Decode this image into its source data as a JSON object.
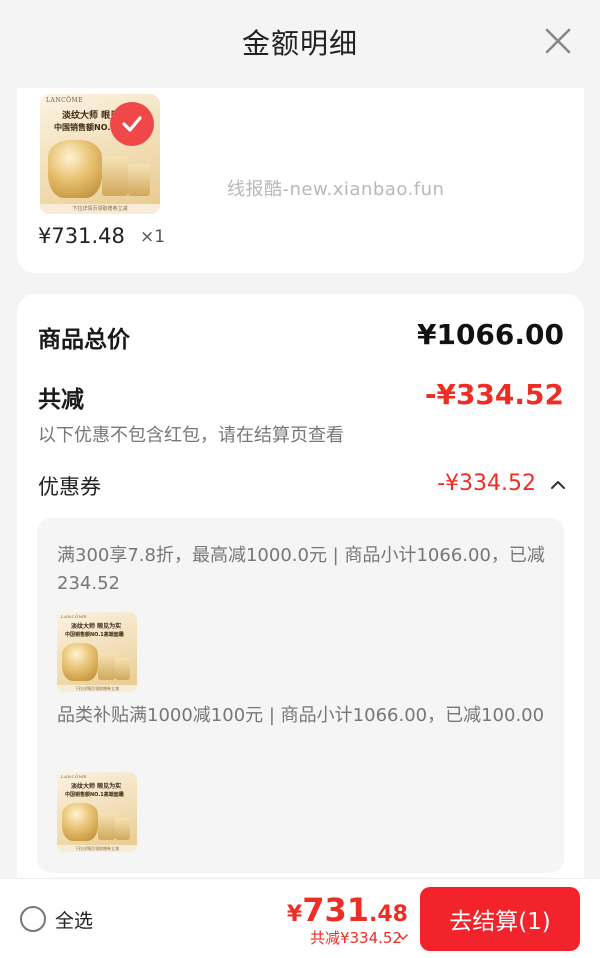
{
  "header": {
    "title": "金额明细"
  },
  "product": {
    "brand": "LANCÔME",
    "image_line1": "淡纹大师 眼见为实",
    "image_line2": "中国销售额NO.1高端面霜",
    "image_strip": "下拉详情页领取赠券立减",
    "price": "¥731.48",
    "quantity": "×1"
  },
  "watermark": "线报酷-new.xianbao.fun",
  "summary": {
    "total_label": "商品总价",
    "total_value": "¥1066.00",
    "discount_label": "共减",
    "discount_value": "-¥334.52",
    "note": "以下优惠不包含红包，请在结算页查看",
    "coupon_label": "优惠券",
    "coupon_value": "-¥334.52",
    "details": [
      {
        "text": "满300享7.8折，最高减1000.0元 | 商品小计1066.00，已减234.52"
      },
      {
        "text": "品类补贴满1000减100元 | 商品小计1066.00，已减100.00"
      }
    ]
  },
  "bottom_bar": {
    "select_all": "全选",
    "price_currency": "¥",
    "price_integer": "731",
    "price_decimal": ".48",
    "total_discount": "共减¥334.52",
    "checkout_label": "去结算(1)"
  },
  "colors": {
    "accent_red": "#ee2e24",
    "checkout_red": "#f2232b"
  }
}
